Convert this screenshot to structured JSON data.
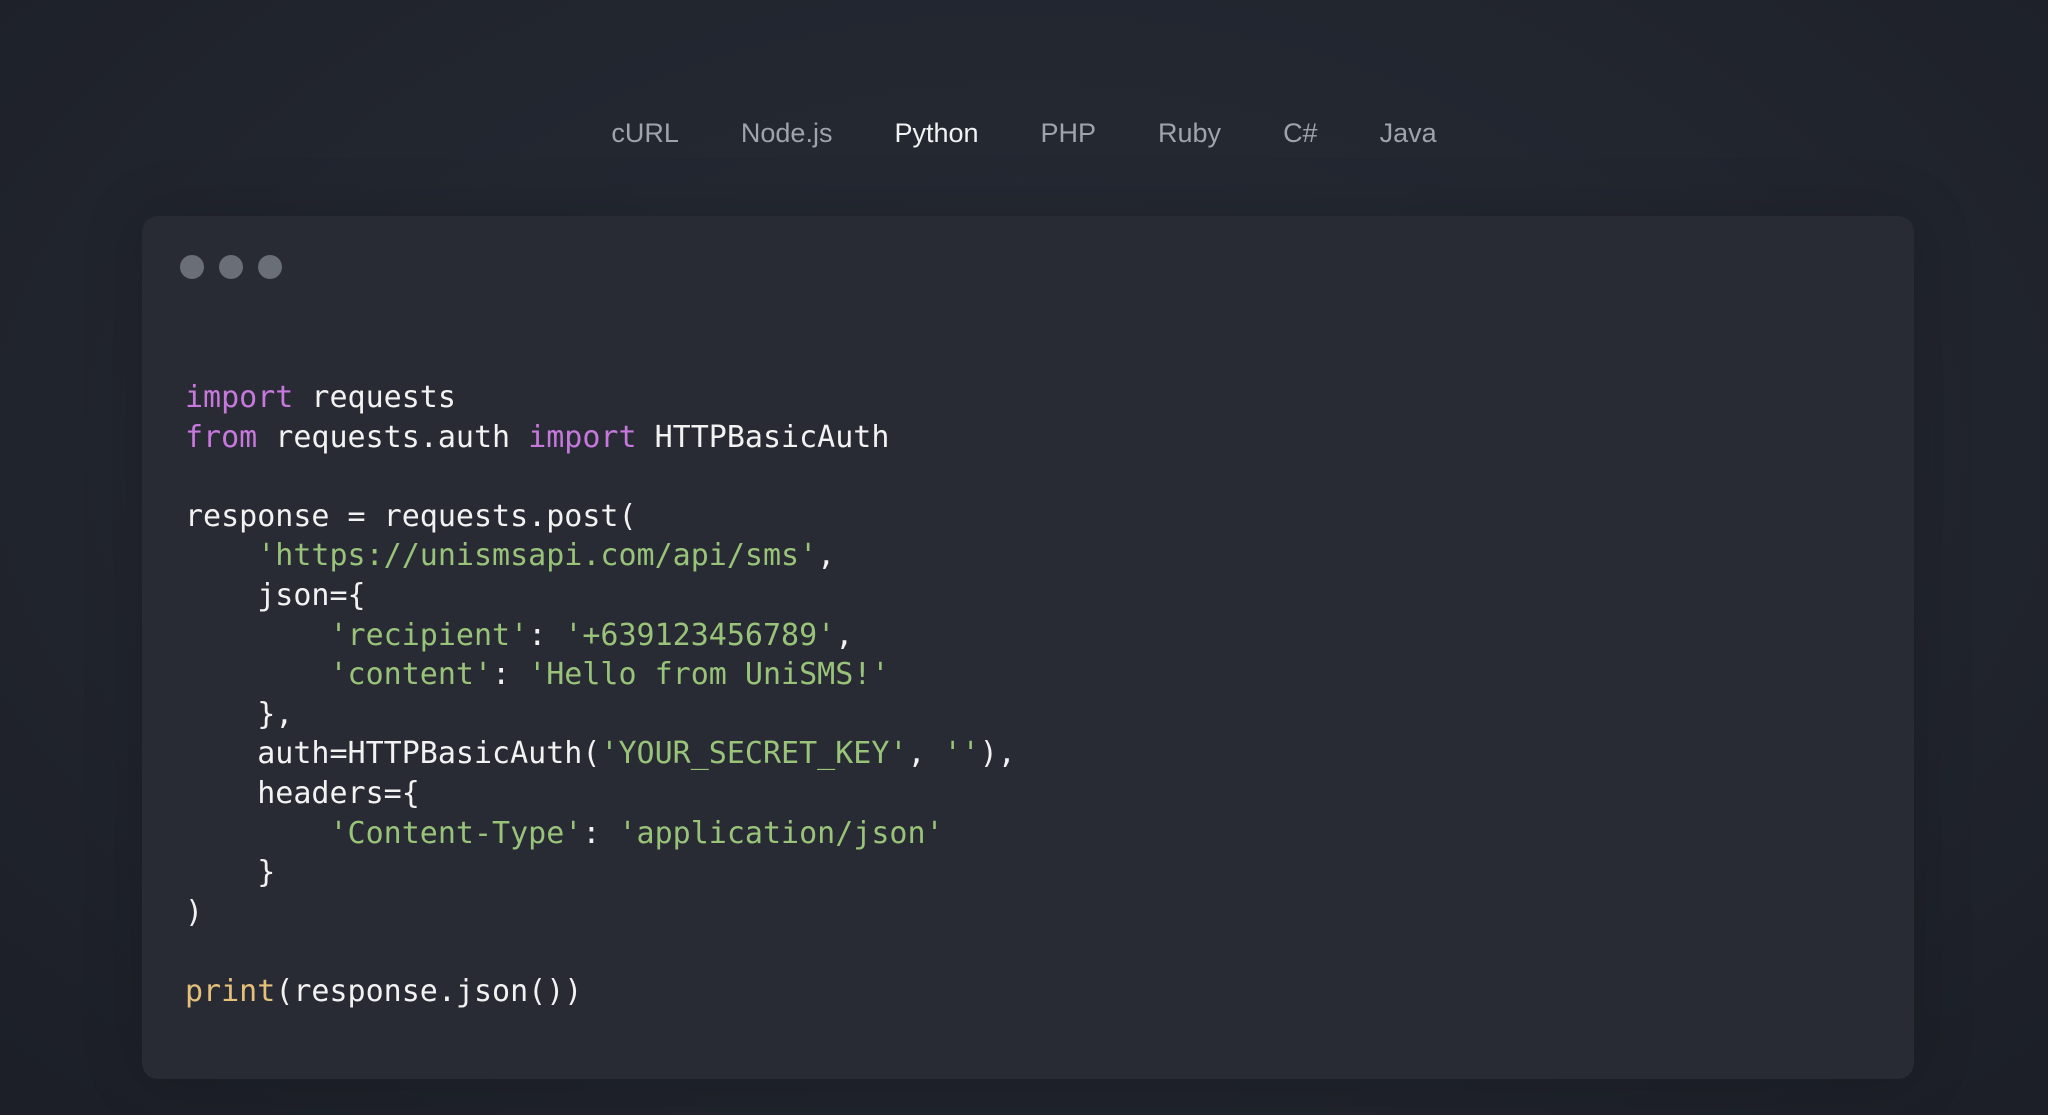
{
  "tabs": [
    {
      "label": "cURL",
      "active": false
    },
    {
      "label": "Node.js",
      "active": false
    },
    {
      "label": "Python",
      "active": true
    },
    {
      "label": "PHP",
      "active": false
    },
    {
      "label": "Ruby",
      "active": false
    },
    {
      "label": "C#",
      "active": false
    },
    {
      "label": "Java",
      "active": false
    }
  ],
  "window": {
    "controls": [
      "dot",
      "dot",
      "dot"
    ]
  },
  "code": {
    "language": "Python",
    "lines": [
      [
        {
          "t": "kw",
          "v": "import"
        },
        {
          "t": "txt",
          "v": " requests"
        }
      ],
      [
        {
          "t": "kw",
          "v": "from"
        },
        {
          "t": "txt",
          "v": " requests.auth "
        },
        {
          "t": "kw",
          "v": "import"
        },
        {
          "t": "txt",
          "v": " HTTPBasicAuth"
        }
      ],
      [],
      [
        {
          "t": "txt",
          "v": "response = requests.post("
        }
      ],
      [
        {
          "t": "txt",
          "v": "    "
        },
        {
          "t": "str",
          "v": "'https://unismsapi.com/api/sms'"
        },
        {
          "t": "txt",
          "v": ","
        }
      ],
      [
        {
          "t": "txt",
          "v": "    json={"
        }
      ],
      [
        {
          "t": "txt",
          "v": "        "
        },
        {
          "t": "str",
          "v": "'recipient'"
        },
        {
          "t": "txt",
          "v": ": "
        },
        {
          "t": "str",
          "v": "'+639123456789'"
        },
        {
          "t": "txt",
          "v": ","
        }
      ],
      [
        {
          "t": "txt",
          "v": "        "
        },
        {
          "t": "str",
          "v": "'content'"
        },
        {
          "t": "txt",
          "v": ": "
        },
        {
          "t": "str",
          "v": "'Hello from UniSMS!'"
        }
      ],
      [
        {
          "t": "txt",
          "v": "    },"
        }
      ],
      [
        {
          "t": "txt",
          "v": "    auth=HTTPBasicAuth("
        },
        {
          "t": "str",
          "v": "'YOUR_SECRET_KEY'"
        },
        {
          "t": "txt",
          "v": ", "
        },
        {
          "t": "str",
          "v": "''"
        },
        {
          "t": "txt",
          "v": "),"
        }
      ],
      [
        {
          "t": "txt",
          "v": "    headers={"
        }
      ],
      [
        {
          "t": "txt",
          "v": "        "
        },
        {
          "t": "str",
          "v": "'Content-Type'"
        },
        {
          "t": "txt",
          "v": ": "
        },
        {
          "t": "str",
          "v": "'application/json'"
        }
      ],
      [
        {
          "t": "txt",
          "v": "    }"
        }
      ],
      [
        {
          "t": "txt",
          "v": ")"
        }
      ],
      [],
      [
        {
          "t": "fn",
          "v": "print"
        },
        {
          "t": "txt",
          "v": "(response.json())"
        }
      ]
    ]
  },
  "colors": {
    "background": "#22262f",
    "window": "#282b33",
    "tab_inactive": "#9ea3ad",
    "tab_active": "#f1f2f4",
    "keyword": "#c678dd",
    "string": "#98c379",
    "builtin": "#e5c07b",
    "text": "#f2f2f2",
    "window_dot": "#6a6e77"
  }
}
